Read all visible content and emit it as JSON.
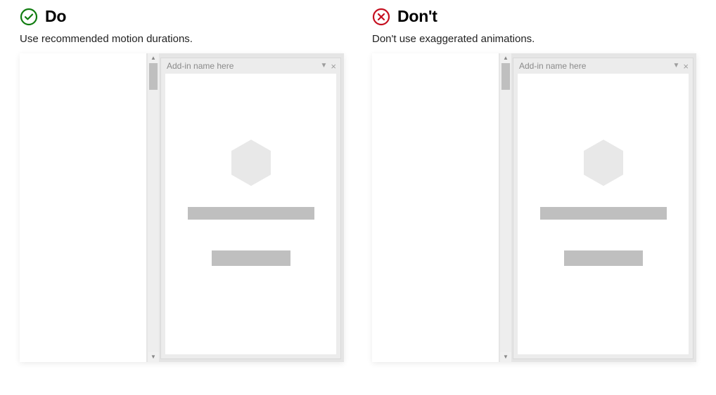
{
  "do": {
    "title": "Do",
    "subtitle": "Use recommended motion durations.",
    "icon_color": "#107c10",
    "pane_title": "Add-in name here"
  },
  "dont": {
    "title": "Don't",
    "subtitle": "Don't use exaggerated animations.",
    "icon_color": "#c50f1f",
    "pane_title": "Add-in name here"
  }
}
